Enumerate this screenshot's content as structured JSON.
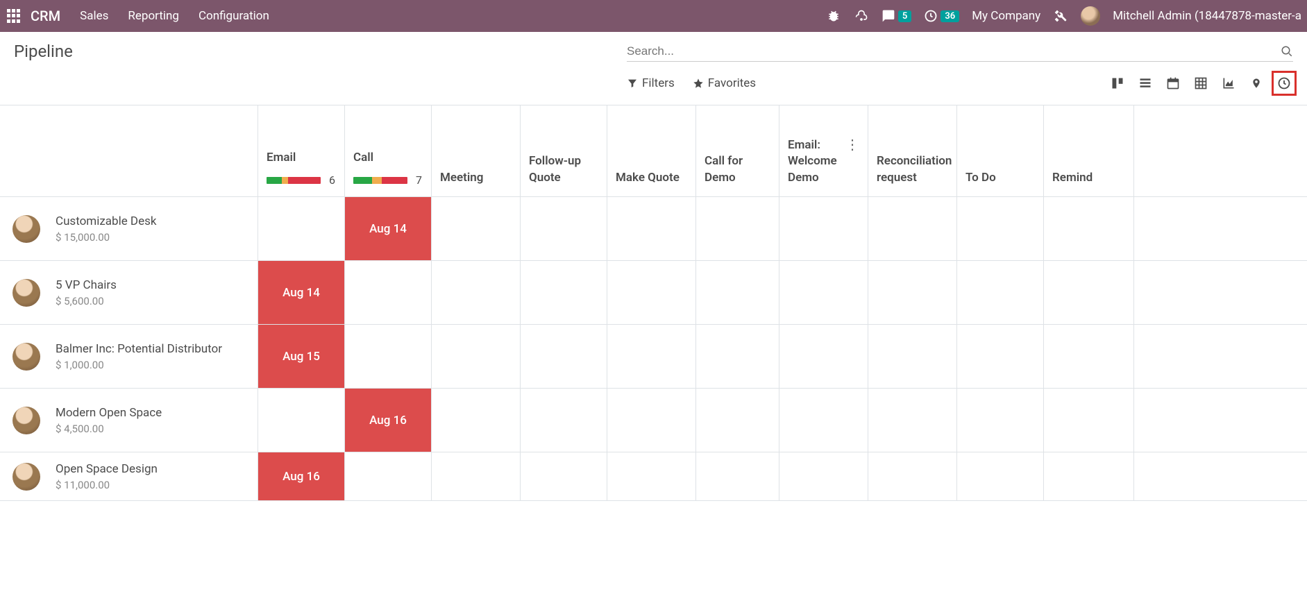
{
  "topbar": {
    "brand": "CRM",
    "links": [
      "Sales",
      "Reporting",
      "Configuration"
    ],
    "chat_badge": "5",
    "clock_badge": "36",
    "company": "My Company",
    "user": "Mitchell Admin (18447878-master-a"
  },
  "page": {
    "title": "Pipeline",
    "search_placeholder": "Search...",
    "filters_label": "Filters",
    "favorites_label": "Favorites"
  },
  "columns": [
    {
      "title": "Email",
      "count": "6",
      "gauge": [
        28,
        12,
        60
      ]
    },
    {
      "title": "Call",
      "count": "7",
      "gauge": [
        35,
        18,
        47
      ]
    },
    {
      "title": "Meeting"
    },
    {
      "title": "Follow-up Quote"
    },
    {
      "title": "Make Quote"
    },
    {
      "title": "Call for Demo"
    },
    {
      "title": "Email: Welcome Demo",
      "kebab": true
    },
    {
      "title": "Reconciliation request"
    },
    {
      "title": "To Do"
    },
    {
      "title": "Remind"
    }
  ],
  "rows": [
    {
      "name": "Customizable Desk",
      "amount": "$ 15,000.00",
      "cells": {
        "1": "Aug 14"
      }
    },
    {
      "name": "5 VP Chairs",
      "amount": "$ 5,600.00",
      "cells": {
        "0": "Aug 14"
      }
    },
    {
      "name": "Balmer Inc: Potential Distributor",
      "amount": "$ 1,000.00",
      "cells": {
        "0": "Aug 15"
      }
    },
    {
      "name": "Modern Open Space",
      "amount": "$ 4,500.00",
      "cells": {
        "1": "Aug 16"
      }
    },
    {
      "name": "Open Space Design",
      "amount": "$ 11,000.00",
      "cells": {
        "0": "Aug 16"
      }
    }
  ]
}
